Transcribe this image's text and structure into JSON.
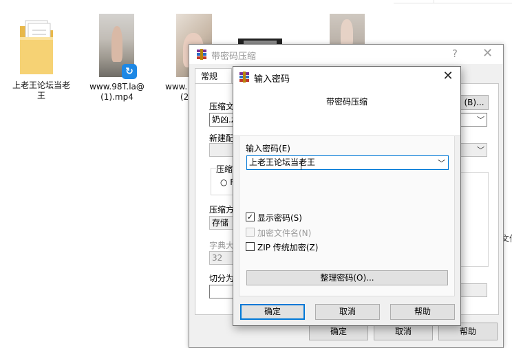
{
  "explorer": {
    "items": [
      {
        "label_line1": "上老王论坛当老",
        "label_line2": "王",
        "kind": "folder"
      },
      {
        "label_line1": "www.98T.la@",
        "label_line2": "(1).mp4",
        "kind": "video"
      },
      {
        "label_line1": "www.",
        "label_line2": "(2",
        "kind": "video"
      }
    ],
    "edge_fragment": "文件"
  },
  "compress_dialog": {
    "title": "带密码压缩",
    "help_glyph": "?",
    "close_glyph": "✕",
    "tab_general": "常规",
    "archive_name_label": "压缩文",
    "archive_name_value": "奶凶.z",
    "browse_button": "(B)...",
    "update_mode_label": "新建配",
    "archive_format_label": "压缩文",
    "format_radio": "R",
    "compression_method_label": "压缩方",
    "compression_method_value": "存储",
    "dictionary_size_label": "字典大",
    "dictionary_size_value": "32",
    "split_label": "切分为",
    "ok_button": "确定",
    "cancel_button": "取消",
    "help_button": "帮助"
  },
  "password_dialog": {
    "title": "输入密码",
    "close_glyph": "✕",
    "subtitle": "带密码压缩",
    "password_label": "输入密码(E)",
    "password_value": "上老王论坛当老王",
    "show_password": {
      "label": "显示密码(S)",
      "checked": true
    },
    "encrypt_filenames": {
      "label": "加密文件名(N)",
      "checked": false
    },
    "zip_legacy": {
      "label": "ZIP 传统加密(Z)",
      "checked": false
    },
    "organize_button": "整理密码(O)...",
    "ok_button": "确定",
    "cancel_button": "取消",
    "help_button": "帮助"
  }
}
